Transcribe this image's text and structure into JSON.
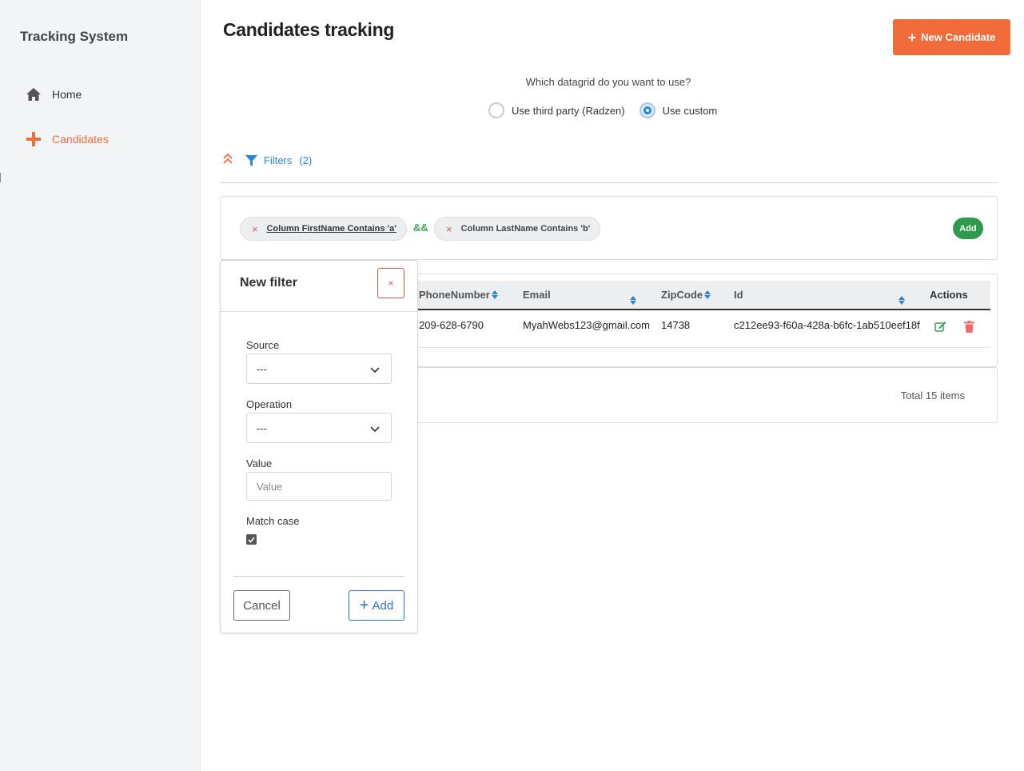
{
  "sidebar": {
    "brand": "Tracking System",
    "items": [
      {
        "label": "Home",
        "icon": "home-icon"
      },
      {
        "label": "Candidates",
        "icon": "plus-icon"
      }
    ]
  },
  "header": {
    "title": "Candidates tracking",
    "new_button_label": "New Candidate"
  },
  "datagrid_choice": {
    "question": "Which datagrid do you want to use?",
    "options": [
      {
        "label": "Use third party (Radzen)",
        "selected": false
      },
      {
        "label": "Use custom",
        "selected": true
      }
    ]
  },
  "filters": {
    "label": "Filters",
    "count": "(2)",
    "chips": [
      {
        "text": "Column FirstName Contains 'a'"
      },
      {
        "text": "Column LastName Contains 'b'"
      }
    ],
    "joiner": "&&",
    "add_label": "Add"
  },
  "grid": {
    "columns": [
      "PhoneNumber",
      "Email",
      "ZipCode",
      "Id",
      "Actions"
    ],
    "rows": [
      {
        "phone": "209-628-6790",
        "email": "MyahWebs123@gmail.com",
        "zip": "14738",
        "id": "c212ee93-f60a-428a-b6fc-1ab510eef18f"
      }
    ],
    "total": "Total 15 items"
  },
  "new_filter_popup": {
    "title": "New filter",
    "close_label": "×",
    "source_label": "Source",
    "source_value": "---",
    "operation_label": "Operation",
    "operation_value": "---",
    "value_label": "Value",
    "value_placeholder": "Value",
    "match_case_label": "Match case",
    "match_case_checked": true,
    "cancel_label": "Cancel",
    "add_label": "Add"
  },
  "colors": {
    "accent": "#f26b3a",
    "link": "#2a86d6",
    "success": "#2e9a4c",
    "danger": "#d9534f"
  }
}
